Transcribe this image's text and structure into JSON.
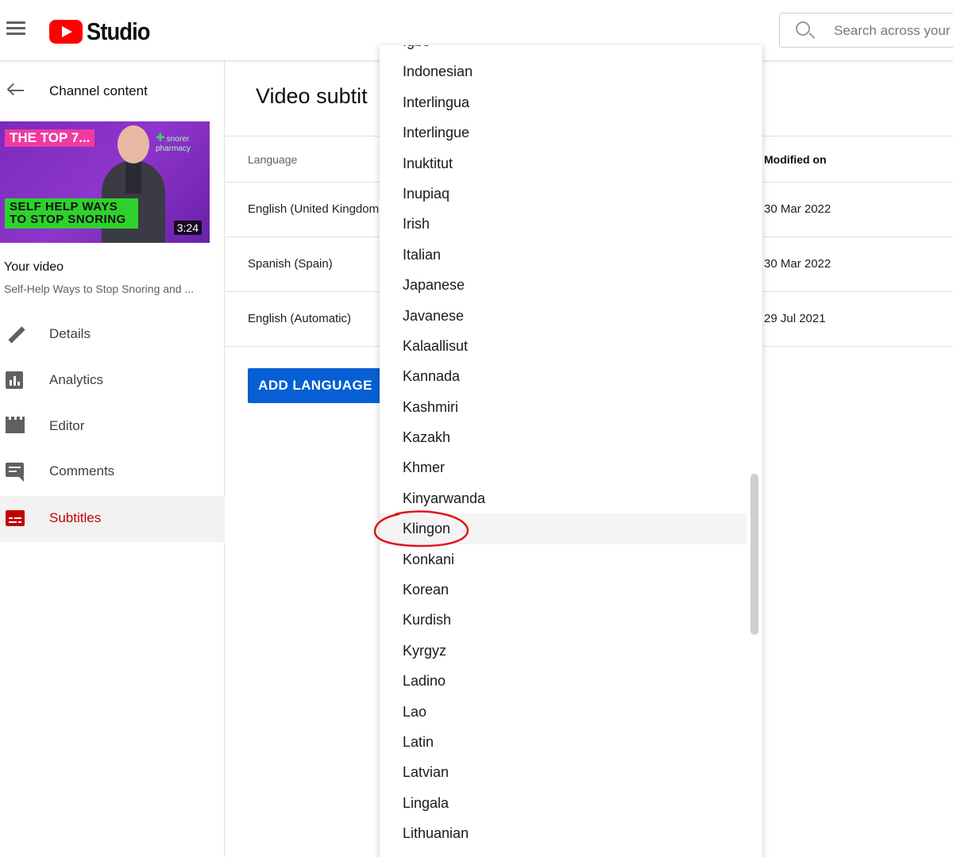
{
  "header": {
    "logo_text": "Studio",
    "search_placeholder": "Search across your c"
  },
  "sidebar": {
    "back_label": "Channel content",
    "thumbnail": {
      "badge_top": "THE TOP 7...",
      "brand": "snorer pharmacy",
      "headline_line1": "SELF HELP WAYS",
      "headline_line2": "TO STOP SNORING",
      "duration": "3:24"
    },
    "your_video_label": "Your video",
    "video_title": "Self-Help Ways to Stop Snoring and ...",
    "items": [
      {
        "label": "Details",
        "icon": "pencil-icon",
        "active": false
      },
      {
        "label": "Analytics",
        "icon": "analytics-icon",
        "active": false
      },
      {
        "label": "Editor",
        "icon": "editor-icon",
        "active": false
      },
      {
        "label": "Comments",
        "icon": "comments-icon",
        "active": false
      },
      {
        "label": "Subtitles",
        "icon": "subtitles-icon",
        "active": true
      }
    ]
  },
  "main": {
    "title": "Video subtit",
    "columns": {
      "language": "Language",
      "modified": "Modified on"
    },
    "rows": [
      {
        "language": "English (United Kingdom",
        "modified": "30 Mar 2022"
      },
      {
        "language": "Spanish (Spain)",
        "modified": "30 Mar 2022"
      },
      {
        "language": "English (Automatic)",
        "modified": "29 Jul 2021"
      }
    ],
    "add_button": "ADD LANGUAGE"
  },
  "dropdown": {
    "options": [
      "Igbo",
      "Indonesian",
      "Interlingua",
      "Interlingue",
      "Inuktitut",
      "Inupiaq",
      "Irish",
      "Italian",
      "Japanese",
      "Javanese",
      "Kalaallisut",
      "Kannada",
      "Kashmiri",
      "Kazakh",
      "Khmer",
      "Kinyarwanda",
      "Klingon",
      "Konkani",
      "Korean",
      "Kurdish",
      "Kyrgyz",
      "Ladino",
      "Lao",
      "Latin",
      "Latvian",
      "Lingala",
      "Lithuanian"
    ],
    "highlighted": "Klingon"
  },
  "colors": {
    "accent_blue": "#065fd4",
    "active_red": "#c40000",
    "annotation_red": "#e0141e"
  }
}
